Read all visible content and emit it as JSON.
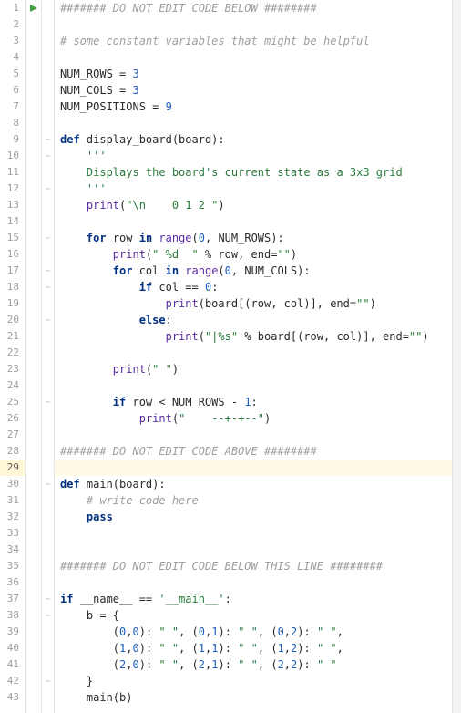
{
  "editor": {
    "lines": [
      {
        "num": 1,
        "run": true,
        "fold": "",
        "tokens": [
          [
            "cm",
            "####### DO NOT EDIT CODE BELOW ########"
          ]
        ]
      },
      {
        "num": 2,
        "run": false,
        "fold": "",
        "tokens": []
      },
      {
        "num": 3,
        "run": false,
        "fold": "",
        "tokens": [
          [
            "cm",
            "# some constant variables that might be helpful"
          ]
        ]
      },
      {
        "num": 4,
        "run": false,
        "fold": "",
        "tokens": []
      },
      {
        "num": 5,
        "run": false,
        "fold": "",
        "tokens": [
          [
            "op",
            "NUM_ROWS = "
          ],
          [
            "num",
            "3"
          ]
        ]
      },
      {
        "num": 6,
        "run": false,
        "fold": "",
        "tokens": [
          [
            "op",
            "NUM_COLS = "
          ],
          [
            "num",
            "3"
          ]
        ]
      },
      {
        "num": 7,
        "run": false,
        "fold": "",
        "tokens": [
          [
            "op",
            "NUM_POSITIONS = "
          ],
          [
            "num",
            "9"
          ]
        ]
      },
      {
        "num": 8,
        "run": false,
        "fold": "",
        "tokens": []
      },
      {
        "num": 9,
        "run": false,
        "fold": "−",
        "tokens": [
          [
            "kw",
            "def "
          ],
          [
            "fn",
            "display_board(board):"
          ]
        ]
      },
      {
        "num": 10,
        "run": false,
        "fold": "−",
        "tokens": [
          [
            "op",
            "    "
          ],
          [
            "st",
            "'''"
          ]
        ]
      },
      {
        "num": 11,
        "run": false,
        "fold": "",
        "tokens": [
          [
            "op",
            "    "
          ],
          [
            "st",
            "Displays the board's current state as a 3x3 grid"
          ]
        ]
      },
      {
        "num": 12,
        "run": false,
        "fold": "−",
        "tokens": [
          [
            "op",
            "    "
          ],
          [
            "st",
            "'''"
          ]
        ]
      },
      {
        "num": 13,
        "run": false,
        "fold": "",
        "tokens": [
          [
            "op",
            "    "
          ],
          [
            "bi",
            "print"
          ],
          [
            "op",
            "("
          ],
          [
            "st",
            "\"\\n    0 1 2 \""
          ],
          [
            "op",
            ")"
          ]
        ]
      },
      {
        "num": 14,
        "run": false,
        "fold": "",
        "tokens": []
      },
      {
        "num": 15,
        "run": false,
        "fold": "−",
        "tokens": [
          [
            "op",
            "    "
          ],
          [
            "kw",
            "for "
          ],
          [
            "op",
            "row "
          ],
          [
            "kw",
            "in "
          ],
          [
            "bi",
            "range"
          ],
          [
            "op",
            "("
          ],
          [
            "num",
            "0"
          ],
          [
            "op",
            ", NUM_ROWS):"
          ]
        ]
      },
      {
        "num": 16,
        "run": false,
        "fold": "",
        "tokens": [
          [
            "op",
            "        "
          ],
          [
            "bi",
            "print"
          ],
          [
            "op",
            "("
          ],
          [
            "st",
            "\" %d  \""
          ],
          [
            "op",
            " % row, end="
          ],
          [
            "st",
            "\"\""
          ],
          [
            "op",
            ")"
          ]
        ]
      },
      {
        "num": 17,
        "run": false,
        "fold": "−",
        "tokens": [
          [
            "op",
            "        "
          ],
          [
            "kw",
            "for "
          ],
          [
            "op",
            "col "
          ],
          [
            "kw",
            "in "
          ],
          [
            "bi",
            "range"
          ],
          [
            "op",
            "("
          ],
          [
            "num",
            "0"
          ],
          [
            "op",
            ", NUM_COLS):"
          ]
        ]
      },
      {
        "num": 18,
        "run": false,
        "fold": "−",
        "tokens": [
          [
            "op",
            "            "
          ],
          [
            "kw",
            "if "
          ],
          [
            "op",
            "col == "
          ],
          [
            "num",
            "0"
          ],
          [
            "op",
            ":"
          ]
        ]
      },
      {
        "num": 19,
        "run": false,
        "fold": "",
        "tokens": [
          [
            "op",
            "                "
          ],
          [
            "bi",
            "print"
          ],
          [
            "op",
            "(board[(row, col)], end="
          ],
          [
            "st",
            "\"\""
          ],
          [
            "op",
            ")"
          ]
        ]
      },
      {
        "num": 20,
        "run": false,
        "fold": "−",
        "tokens": [
          [
            "op",
            "            "
          ],
          [
            "kw",
            "else"
          ],
          [
            "op",
            ":"
          ]
        ]
      },
      {
        "num": 21,
        "run": false,
        "fold": "",
        "tokens": [
          [
            "op",
            "                "
          ],
          [
            "bi",
            "print"
          ],
          [
            "op",
            "("
          ],
          [
            "st",
            "\"|%s\""
          ],
          [
            "op",
            " % board[(row, col)], end="
          ],
          [
            "st",
            "\"\""
          ],
          [
            "op",
            ")"
          ]
        ]
      },
      {
        "num": 22,
        "run": false,
        "fold": "",
        "tokens": []
      },
      {
        "num": 23,
        "run": false,
        "fold": "",
        "tokens": [
          [
            "op",
            "        "
          ],
          [
            "bi",
            "print"
          ],
          [
            "op",
            "("
          ],
          [
            "st",
            "\" \""
          ],
          [
            "op",
            ")"
          ]
        ]
      },
      {
        "num": 24,
        "run": false,
        "fold": "",
        "tokens": []
      },
      {
        "num": 25,
        "run": false,
        "fold": "−",
        "tokens": [
          [
            "op",
            "        "
          ],
          [
            "kw",
            "if "
          ],
          [
            "op",
            "row < NUM_ROWS - "
          ],
          [
            "num",
            "1"
          ],
          [
            "op",
            ":"
          ]
        ]
      },
      {
        "num": 26,
        "run": false,
        "fold": "",
        "tokens": [
          [
            "op",
            "            "
          ],
          [
            "bi",
            "print"
          ],
          [
            "op",
            "("
          ],
          [
            "st",
            "\"    --+-+--\""
          ],
          [
            "op",
            ")"
          ]
        ]
      },
      {
        "num": 27,
        "run": false,
        "fold": "",
        "tokens": []
      },
      {
        "num": 28,
        "run": false,
        "fold": "",
        "tokens": [
          [
            "cm",
            "####### DO NOT EDIT CODE ABOVE ########"
          ]
        ]
      },
      {
        "num": 29,
        "run": false,
        "fold": "",
        "tokens": [],
        "current": true
      },
      {
        "num": 30,
        "run": false,
        "fold": "−",
        "tokens": [
          [
            "kw",
            "def "
          ],
          [
            "fn",
            "main(board):"
          ]
        ]
      },
      {
        "num": 31,
        "run": false,
        "fold": "",
        "tokens": [
          [
            "op",
            "    "
          ],
          [
            "cm",
            "# write code here"
          ]
        ]
      },
      {
        "num": 32,
        "run": false,
        "fold": "",
        "tokens": [
          [
            "op",
            "    "
          ],
          [
            "kw",
            "pass"
          ]
        ]
      },
      {
        "num": 33,
        "run": false,
        "fold": "",
        "tokens": []
      },
      {
        "num": 34,
        "run": false,
        "fold": "",
        "tokens": []
      },
      {
        "num": 35,
        "run": false,
        "fold": "",
        "tokens": [
          [
            "cm",
            "####### DO NOT EDIT CODE BELOW THIS LINE ########"
          ]
        ]
      },
      {
        "num": 36,
        "run": false,
        "fold": "",
        "tokens": []
      },
      {
        "num": 37,
        "run": false,
        "fold": "−",
        "tokens": [
          [
            "kw",
            "if "
          ],
          [
            "op",
            "__name__ == "
          ],
          [
            "st",
            "'__main__'"
          ],
          [
            "op",
            ":"
          ]
        ]
      },
      {
        "num": 38,
        "run": false,
        "fold": "−",
        "tokens": [
          [
            "op",
            "    b = {"
          ]
        ]
      },
      {
        "num": 39,
        "run": false,
        "fold": "",
        "tokens": [
          [
            "op",
            "        ("
          ],
          [
            "num",
            "0"
          ],
          [
            "op",
            ","
          ],
          [
            "num",
            "0"
          ],
          [
            "op",
            "): "
          ],
          [
            "st",
            "\" \""
          ],
          [
            "op",
            ", ("
          ],
          [
            "num",
            "0"
          ],
          [
            "op",
            ","
          ],
          [
            "num",
            "1"
          ],
          [
            "op",
            "): "
          ],
          [
            "st",
            "\" \""
          ],
          [
            "op",
            ", ("
          ],
          [
            "num",
            "0"
          ],
          [
            "op",
            ","
          ],
          [
            "num",
            "2"
          ],
          [
            "op",
            "): "
          ],
          [
            "st",
            "\" \""
          ],
          [
            "op",
            ","
          ]
        ]
      },
      {
        "num": 40,
        "run": false,
        "fold": "",
        "tokens": [
          [
            "op",
            "        ("
          ],
          [
            "num",
            "1"
          ],
          [
            "op",
            ","
          ],
          [
            "num",
            "0"
          ],
          [
            "op",
            "): "
          ],
          [
            "st",
            "\" \""
          ],
          [
            "op",
            ", ("
          ],
          [
            "num",
            "1"
          ],
          [
            "op",
            ","
          ],
          [
            "num",
            "1"
          ],
          [
            "op",
            "): "
          ],
          [
            "st",
            "\" \""
          ],
          [
            "op",
            ", ("
          ],
          [
            "num",
            "1"
          ],
          [
            "op",
            ","
          ],
          [
            "num",
            "2"
          ],
          [
            "op",
            "): "
          ],
          [
            "st",
            "\" \""
          ],
          [
            "op",
            ","
          ]
        ]
      },
      {
        "num": 41,
        "run": false,
        "fold": "",
        "tokens": [
          [
            "op",
            "        ("
          ],
          [
            "num",
            "2"
          ],
          [
            "op",
            ","
          ],
          [
            "num",
            "0"
          ],
          [
            "op",
            "): "
          ],
          [
            "st",
            "\" \""
          ],
          [
            "op",
            ", ("
          ],
          [
            "num",
            "2"
          ],
          [
            "op",
            ","
          ],
          [
            "num",
            "1"
          ],
          [
            "op",
            "): "
          ],
          [
            "st",
            "\" \""
          ],
          [
            "op",
            ", ("
          ],
          [
            "num",
            "2"
          ],
          [
            "op",
            ","
          ],
          [
            "num",
            "2"
          ],
          [
            "op",
            "): "
          ],
          [
            "st",
            "\" \""
          ]
        ]
      },
      {
        "num": 42,
        "run": false,
        "fold": "−",
        "tokens": [
          [
            "op",
            "    }"
          ]
        ]
      },
      {
        "num": 43,
        "run": false,
        "fold": "",
        "tokens": [
          [
            "op",
            "    main(b)"
          ]
        ]
      }
    ]
  }
}
